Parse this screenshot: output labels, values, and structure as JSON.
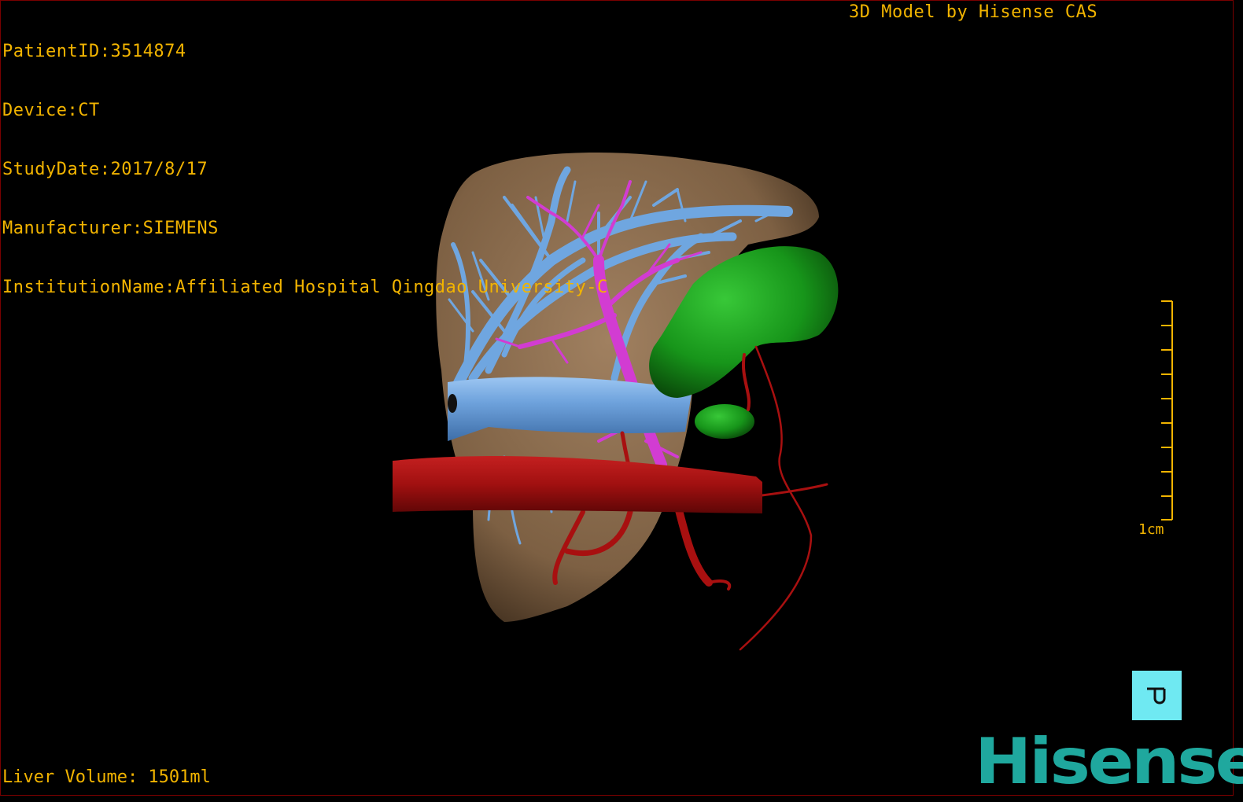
{
  "header": {
    "patient_id": "PatientID:3514874",
    "device": "Device:CT",
    "study_date": "StudyDate:2017/8/17",
    "manufacturer": "Manufacturer:SIEMENS",
    "institution": "InstitutionName:Affiliated Hospital Qingdao University-C",
    "model_credit": "3D Model by Hisense CAS"
  },
  "footer": {
    "liver_volume": "Liver Volume: 1501ml"
  },
  "scale_bar": {
    "label": "1cm",
    "tick_count": 10
  },
  "toolbar": {
    "tool_icon": "toggle-tool-icon"
  },
  "brand": {
    "name": "Hisense"
  },
  "colors": {
    "overlay_text": "#f2b400",
    "liver": "#8a6a4a",
    "hepatic_vein": "#6fa6e0",
    "portal_vein": "#d23cd2",
    "artery": "#a81010",
    "gallbladder": "#1a9a1a",
    "tool_button": "#6fe9f2",
    "brand": "#1fa89e"
  }
}
